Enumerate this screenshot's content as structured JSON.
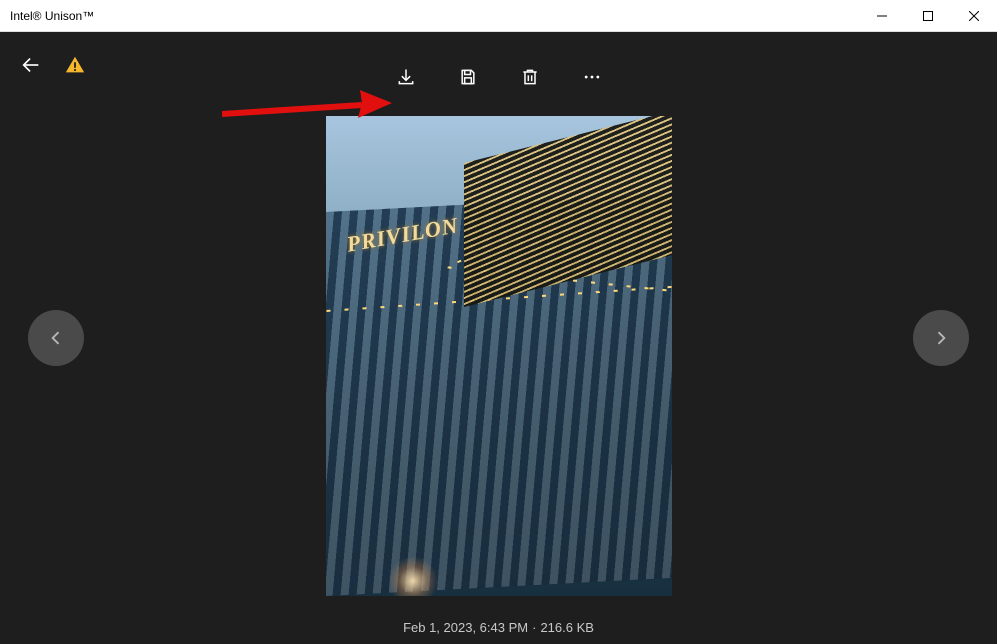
{
  "window": {
    "title": "Intel® Unison™"
  },
  "toolbar": {
    "back_label": "Back",
    "warning_label": "Warning",
    "download_label": "Download",
    "save_label": "Save",
    "delete_label": "Delete",
    "more_label": "More options"
  },
  "nav": {
    "prev_label": "Previous",
    "next_label": "Next"
  },
  "photo": {
    "signage_text": "PRIVILON"
  },
  "status": {
    "timestamp": "Feb 1, 2023, 6:43 PM",
    "separator": "·",
    "filesize": "216.6 KB"
  }
}
